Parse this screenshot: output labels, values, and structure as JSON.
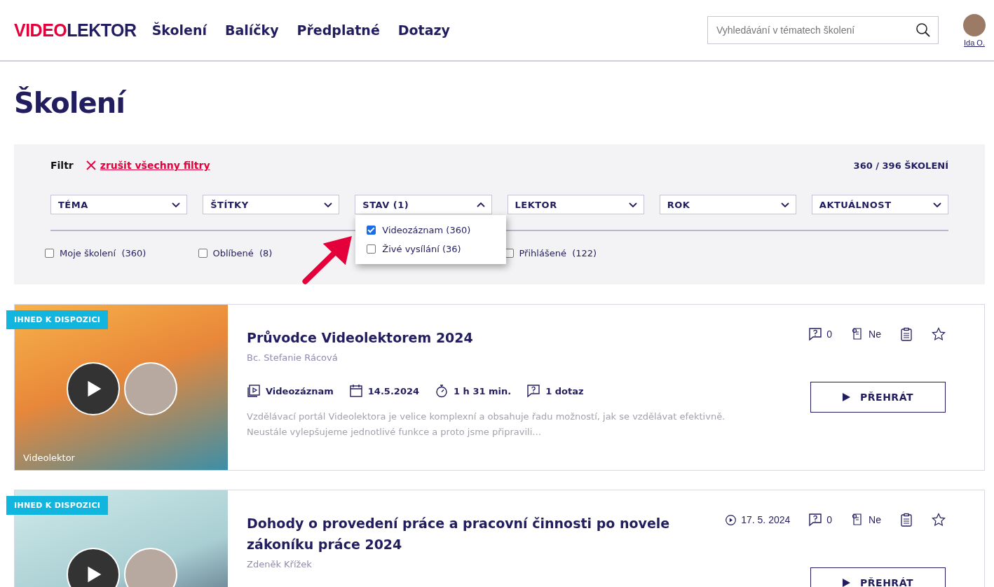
{
  "header": {
    "logo_part1": "VIDEO",
    "logo_part2": "LEKTOR",
    "nav": [
      {
        "label": "Školení"
      },
      {
        "label": "Balíčky"
      },
      {
        "label": "Předplatné"
      },
      {
        "label": "Dotazy"
      }
    ],
    "search": {
      "placeholder": "Vyhledávání v tématech školení"
    },
    "user": {
      "name": "Ida O."
    }
  },
  "page_title": "Školení",
  "filter": {
    "label": "Filtr",
    "clear_link": "zrušit všechny filtry",
    "count": "360 / 396 ŠKOLENÍ",
    "dropdowns": [
      {
        "label": "TÉMA",
        "expanded": false
      },
      {
        "label": "ŠTÍTKY",
        "expanded": false
      },
      {
        "label": "STAV (1)",
        "expanded": true,
        "options": [
          {
            "label": "Videozáznam (360)",
            "checked": true
          },
          {
            "label": "Živé vysílání (36)",
            "checked": false
          }
        ]
      },
      {
        "label": "LEKTOR",
        "expanded": false
      },
      {
        "label": "ROK",
        "expanded": false
      },
      {
        "label": "AKTUÁLNOST",
        "expanded": false
      }
    ],
    "checkboxes": [
      {
        "label": "Moje školení",
        "count": "(360)",
        "checked": false
      },
      {
        "label": "Oblíbené",
        "count": "(8)",
        "checked": false
      },
      {
        "label": "Přihlášené",
        "count": "(122)",
        "checked": false
      }
    ]
  },
  "courses": [
    {
      "badge": "IHNED K DISPOZICI",
      "thumb_caption": "Videolektor",
      "title": "Průvodce Videolektorem 2024",
      "lecturer": "Bc. Stefanie Rácová",
      "meta": [
        {
          "kind": "questions",
          "text": "0"
        },
        {
          "kind": "certificate",
          "text": "Ne"
        }
      ],
      "details": [
        {
          "kind": "format",
          "text": "Videozáznam"
        },
        {
          "kind": "date",
          "text": "14.5.2024"
        },
        {
          "kind": "duration",
          "text": "1 h 31 min."
        },
        {
          "kind": "questions",
          "text": "1 dotaz"
        }
      ],
      "description": "Vzdělávací portál Videolektora je velice komplexní a obsahuje řadu možností, jak se vzdělávat efektivně. Neustále vylepšujeme jednotlivé funkce a proto jsme připravili…",
      "button": "PŘEHRÁT"
    },
    {
      "badge": "IHNED K DISPOZICI",
      "title": "Dohody o provedení práce a pracovní činnosti po novele zákoníku práce 2024",
      "lecturer": "Zdeněk Křížek",
      "meta": [
        {
          "kind": "start",
          "text": "17. 5. 2024"
        },
        {
          "kind": "questions",
          "text": "0"
        },
        {
          "kind": "certificate",
          "text": "Ne"
        }
      ],
      "button": "PŘEHRÁT"
    }
  ]
}
